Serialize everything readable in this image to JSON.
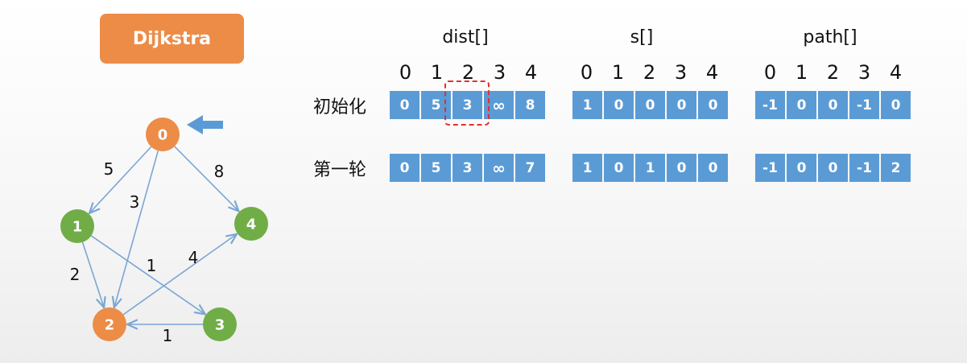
{
  "title": "Dijkstra",
  "graph": {
    "nodes": [
      {
        "id": "0",
        "color": "#ec8c47"
      },
      {
        "id": "1",
        "color": "#70ad47"
      },
      {
        "id": "2",
        "color": "#ec8c47"
      },
      {
        "id": "3",
        "color": "#70ad47"
      },
      {
        "id": "4",
        "color": "#70ad47"
      }
    ],
    "edges": [
      {
        "from": "0",
        "to": "1",
        "weight": "5"
      },
      {
        "from": "0",
        "to": "2",
        "weight": "3"
      },
      {
        "from": "0",
        "to": "4",
        "weight": "8"
      },
      {
        "from": "1",
        "to": "2",
        "weight": "2"
      },
      {
        "from": "1",
        "to": "3",
        "weight": "1"
      },
      {
        "from": "2",
        "to": "4",
        "weight": "4"
      },
      {
        "from": "3",
        "to": "2",
        "weight": "1"
      }
    ],
    "current_node_marker": "0"
  },
  "arrays": {
    "dist": {
      "name": "dist[]"
    },
    "s": {
      "name": "s[]"
    },
    "path": {
      "name": "path[]"
    },
    "indices": [
      "0",
      "1",
      "2",
      "3",
      "4"
    ]
  },
  "rows": [
    {
      "label": "初始化",
      "dist": [
        "0",
        "5",
        "3",
        "∞",
        "8"
      ],
      "s": [
        "1",
        "0",
        "0",
        "0",
        "0"
      ],
      "path": [
        "-1",
        "0",
        "0",
        "-1",
        "0"
      ]
    },
    {
      "label": "第一轮",
      "dist": [
        "0",
        "5",
        "3",
        "∞",
        "7"
      ],
      "s": [
        "1",
        "0",
        "1",
        "0",
        "0"
      ],
      "path": [
        "-1",
        "0",
        "0",
        "-1",
        "2"
      ]
    }
  ],
  "highlight": {
    "row": 0,
    "array": "dist",
    "index": 2
  },
  "colors": {
    "cell": "#5b9bd5",
    "orange": "#ec8c47",
    "green": "#70ad47",
    "edge": "#7aa6d4",
    "highlight": "#e03030"
  }
}
